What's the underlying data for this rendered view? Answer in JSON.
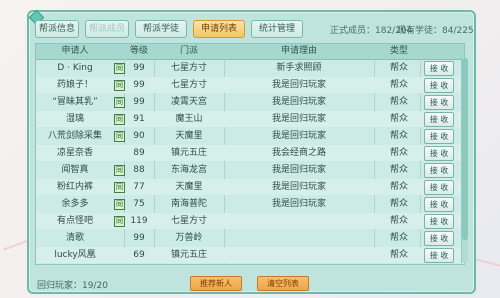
{
  "tabs": [
    {
      "label": "帮派信息",
      "state": "normal"
    },
    {
      "label": "帮派成员",
      "state": "disabled"
    },
    {
      "label": "帮派学徒",
      "state": "normal"
    },
    {
      "label": "申请列表",
      "state": "active"
    },
    {
      "label": "统计管理",
      "state": "normal"
    }
  ],
  "counts": {
    "formal_label": "正式成员：182/204",
    "apprentice_label": "现有学徒：84/225"
  },
  "table": {
    "headers": [
      "申请人",
      "等级",
      "门派",
      "申请理由",
      "类型"
    ],
    "accept_label": "接 收",
    "rows": [
      {
        "name": "D · King",
        "badge": "同",
        "level": "99",
        "school": "七星方寸",
        "reason": "新手求照顾",
        "type": "帮众"
      },
      {
        "name": "药娘子！",
        "badge": "同",
        "level": "99",
        "school": "七星方寸",
        "reason": "我是回归玩家",
        "type": "帮众"
      },
      {
        "name": "“冒昧其乳”",
        "badge": "同",
        "level": "99",
        "school": "凌霄天宫",
        "reason": "我是回归玩家",
        "type": "帮众"
      },
      {
        "name": "湿璃",
        "badge": "同",
        "level": "91",
        "school": "魔王山",
        "reason": "我是回归玩家",
        "type": "帮众"
      },
      {
        "name": "八荒剑除采集",
        "badge": "同",
        "level": "90",
        "school": "天魔里",
        "reason": "我是回归玩家",
        "type": "帮众"
      },
      {
        "name": "凉星奈香",
        "badge": "",
        "level": "89",
        "school": "镇元五庄",
        "reason": "我会经商之路",
        "type": "帮众"
      },
      {
        "name": "闻智真",
        "badge": "同",
        "level": "88",
        "school": "东海龙宫",
        "reason": "我是回归玩家",
        "type": "帮众"
      },
      {
        "name": "粉红内裤",
        "badge": "同",
        "level": "77",
        "school": "天魔里",
        "reason": "我是回归玩家",
        "type": "帮众"
      },
      {
        "name": "余多多",
        "badge": "同",
        "level": "75",
        "school": "南海普陀",
        "reason": "我是回归玩家",
        "type": "帮众"
      },
      {
        "name": "有点怪吧",
        "badge": "同",
        "level": "119",
        "school": "七星方寸",
        "reason": "",
        "type": "帮众"
      },
      {
        "name": "清歌",
        "badge": "",
        "level": "99",
        "school": "万兽岭",
        "reason": "",
        "type": "帮众"
      },
      {
        "name": "lucky风凰",
        "badge": "",
        "level": "69",
        "school": "镇元五庄",
        "reason": "",
        "type": "帮众"
      }
    ]
  },
  "footer": {
    "online_label": "回归玩家：19/20",
    "recruit_label": "推荐新人",
    "clear_label": "清空列表"
  }
}
